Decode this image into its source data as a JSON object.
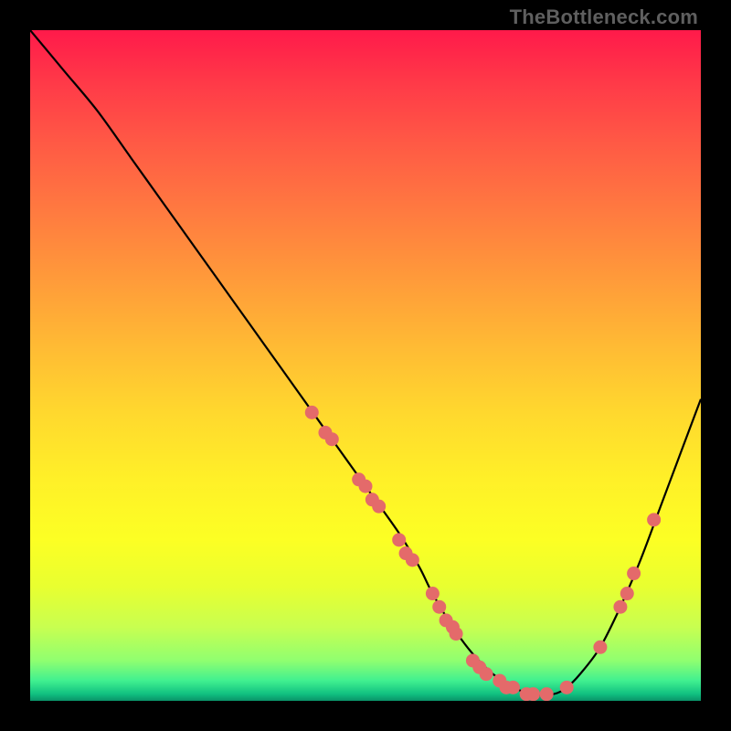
{
  "watermark": "TheBottleneck.com",
  "colors": {
    "curve": "#000000",
    "dot_fill": "#e46a6a",
    "dot_stroke": "#b84a4a"
  },
  "chart_data": {
    "type": "line",
    "title": "",
    "xlabel": "",
    "ylabel": "",
    "xlim": [
      0,
      100
    ],
    "ylim": [
      0,
      100
    ],
    "series": [
      {
        "name": "bottleneck-curve",
        "x": [
          0,
          5,
          10,
          15,
          20,
          25,
          30,
          35,
          40,
          45,
          50,
          55,
          58,
          60,
          63,
          66,
          69,
          72,
          75,
          78,
          80,
          82,
          85,
          88,
          91,
          94,
          97,
          100
        ],
        "y": [
          100,
          94,
          88,
          81,
          74,
          67,
          60,
          53,
          46,
          39,
          32,
          25,
          20,
          16,
          11,
          7,
          4,
          2,
          1,
          1,
          2,
          4,
          8,
          14,
          21,
          29,
          37,
          45
        ]
      }
    ],
    "points": [
      {
        "x": 42,
        "y": 43
      },
      {
        "x": 44,
        "y": 40
      },
      {
        "x": 45,
        "y": 39
      },
      {
        "x": 49,
        "y": 33
      },
      {
        "x": 50,
        "y": 32
      },
      {
        "x": 51,
        "y": 30
      },
      {
        "x": 52,
        "y": 29
      },
      {
        "x": 55,
        "y": 24
      },
      {
        "x": 56,
        "y": 22
      },
      {
        "x": 57,
        "y": 21
      },
      {
        "x": 60,
        "y": 16
      },
      {
        "x": 61,
        "y": 14
      },
      {
        "x": 62,
        "y": 12
      },
      {
        "x": 63,
        "y": 11
      },
      {
        "x": 63.5,
        "y": 10
      },
      {
        "x": 66,
        "y": 6
      },
      {
        "x": 67,
        "y": 5
      },
      {
        "x": 68,
        "y": 4
      },
      {
        "x": 70,
        "y": 3
      },
      {
        "x": 71,
        "y": 2
      },
      {
        "x": 72,
        "y": 2
      },
      {
        "x": 74,
        "y": 1
      },
      {
        "x": 75,
        "y": 1
      },
      {
        "x": 77,
        "y": 1
      },
      {
        "x": 80,
        "y": 2
      },
      {
        "x": 85,
        "y": 8
      },
      {
        "x": 88,
        "y": 14
      },
      {
        "x": 89,
        "y": 16
      },
      {
        "x": 90,
        "y": 19
      },
      {
        "x": 93,
        "y": 27
      }
    ]
  }
}
